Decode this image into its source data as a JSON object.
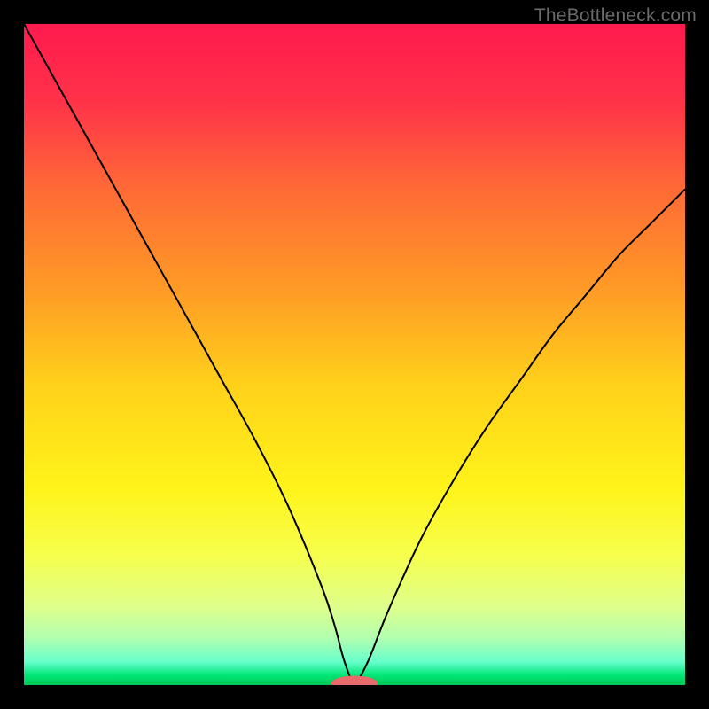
{
  "watermark": "TheBottleneck.com",
  "chart_data": {
    "type": "line",
    "title": "",
    "xlabel": "",
    "ylabel": "",
    "xlim": [
      0,
      100
    ],
    "ylim": [
      0,
      100
    ],
    "grid": false,
    "legend": false,
    "background": {
      "type": "vertical-gradient",
      "stops": [
        {
          "pos": 0.0,
          "color": "#ff1a4f"
        },
        {
          "pos": 0.12,
          "color": "#ff3348"
        },
        {
          "pos": 0.25,
          "color": "#ff6a36"
        },
        {
          "pos": 0.4,
          "color": "#ff9a26"
        },
        {
          "pos": 0.55,
          "color": "#ffd21a"
        },
        {
          "pos": 0.7,
          "color": "#fff31a"
        },
        {
          "pos": 0.8,
          "color": "#f7ff4a"
        },
        {
          "pos": 0.88,
          "color": "#e0ff8a"
        },
        {
          "pos": 0.93,
          "color": "#b0ffb0"
        },
        {
          "pos": 0.965,
          "color": "#66ffcc"
        },
        {
          "pos": 0.985,
          "color": "#00e676"
        },
        {
          "pos": 1.0,
          "color": "#00c853"
        }
      ]
    },
    "series": [
      {
        "name": "bottleneck-curve",
        "color": "#000000",
        "stroke_width": 2,
        "x": [
          0,
          5,
          10,
          15,
          20,
          25,
          30,
          35,
          40,
          45,
          47,
          48.5,
          50,
          52,
          55,
          60,
          65,
          70,
          75,
          80,
          85,
          90,
          95,
          100
        ],
        "y": [
          100,
          91,
          82,
          73,
          64,
          55,
          46,
          37,
          27,
          15,
          9,
          3.5,
          0.5,
          3.5,
          11,
          22,
          31,
          39,
          46,
          53,
          59,
          65,
          70,
          75
        ]
      }
    ],
    "marker": {
      "name": "optimum-marker",
      "x": 50,
      "y": 0.3,
      "rx": 3.5,
      "ry": 1.1,
      "color": "#e86a6a"
    }
  }
}
